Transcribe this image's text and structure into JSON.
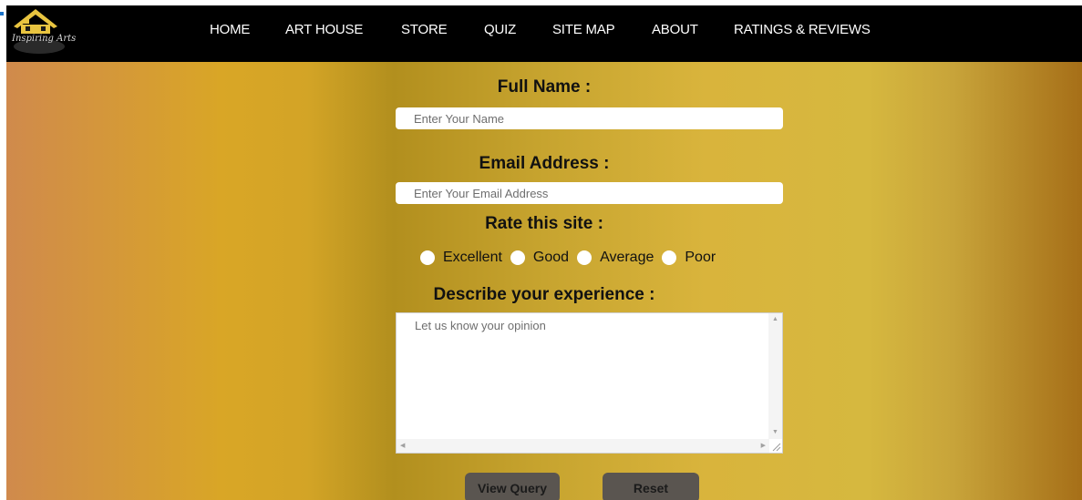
{
  "nav": {
    "logo_text": "Inspiring Arts",
    "items": [
      {
        "label": "HOME"
      },
      {
        "label": "ART HOUSE"
      },
      {
        "label": "STORE"
      },
      {
        "label": "QUIZ"
      },
      {
        "label": "SITE MAP"
      },
      {
        "label": "ABOUT"
      },
      {
        "label": "RATINGS & REVIEWS"
      }
    ]
  },
  "form": {
    "full_name": {
      "label": "Full Name :",
      "placeholder": "Enter Your Name",
      "value": ""
    },
    "email": {
      "label": "Email Address :",
      "placeholder": "Enter Your Email Address",
      "value": ""
    },
    "rating": {
      "label": "Rate this site :",
      "options": [
        {
          "label": "Excellent"
        },
        {
          "label": "Good"
        },
        {
          "label": "Average"
        },
        {
          "label": "Poor"
        }
      ]
    },
    "experience": {
      "label": "Describe your experience :",
      "placeholder": "Let us know your opinion",
      "value": ""
    },
    "buttons": {
      "view_query": "View Query",
      "reset": "Reset"
    }
  },
  "colors": {
    "navbar_bg": "#000000",
    "button_bg": "#5a5550",
    "logo_roof": "#e8c440"
  }
}
